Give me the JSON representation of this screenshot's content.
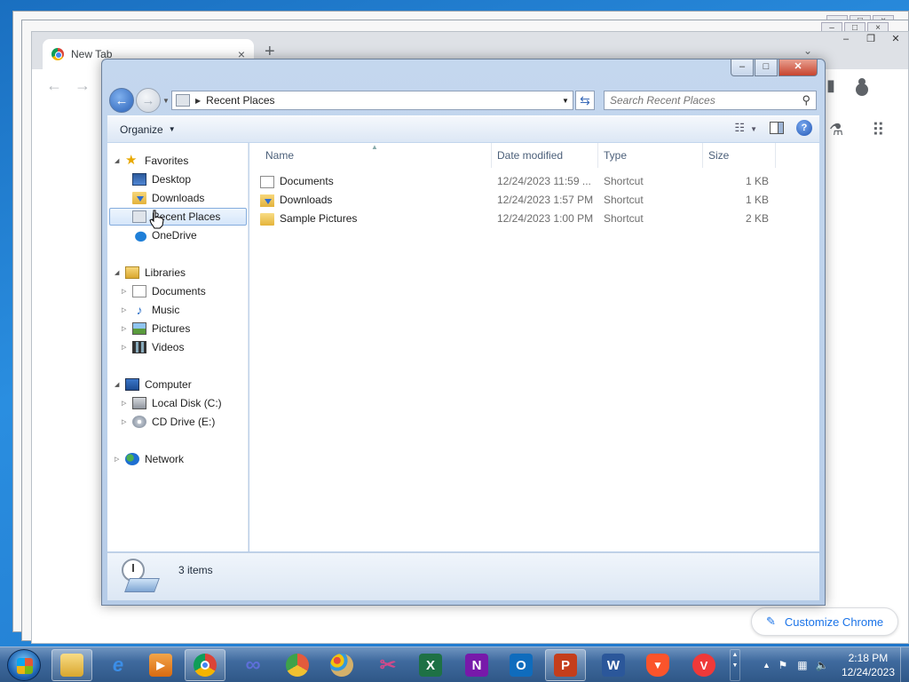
{
  "chrome": {
    "tab_title": "New Tab",
    "tab_close": "×",
    "new_tab": "+",
    "customize_label": "Customize Chrome"
  },
  "explorer": {
    "address_path": "Recent Places",
    "search_placeholder": "Search Recent Places",
    "organize_label": "Organize",
    "nav": {
      "favorites": "Favorites",
      "desktop": "Desktop",
      "downloads": "Downloads",
      "recent_places": "Recent Places",
      "onedrive": "OneDrive",
      "libraries": "Libraries",
      "documents": "Documents",
      "music": "Music",
      "pictures": "Pictures",
      "videos": "Videos",
      "computer": "Computer",
      "local_disk": "Local Disk (C:)",
      "cd_drive": "CD Drive (E:)",
      "network": "Network"
    },
    "columns": {
      "name": "Name",
      "date_modified": "Date modified",
      "type": "Type",
      "size": "Size"
    },
    "files": [
      {
        "name": "Documents",
        "date": "12/24/2023 11:59 ...",
        "type": "Shortcut",
        "size": "1 KB"
      },
      {
        "name": "Downloads",
        "date": "12/24/2023 1:57 PM",
        "type": "Shortcut",
        "size": "1 KB"
      },
      {
        "name": "Sample Pictures",
        "date": "12/24/2023 1:00 PM",
        "type": "Shortcut",
        "size": "2 KB"
      }
    ],
    "status_count": "3 items"
  },
  "taskbar": {
    "time": "2:18 PM",
    "date": "12/24/2023",
    "apps": [
      "file-explorer",
      "internet-explorer",
      "media-player",
      "chrome",
      "infinity",
      "chrome-green",
      "paint",
      "snipping-tool",
      "excel",
      "onenote",
      "outlook",
      "powerpoint",
      "word",
      "brave",
      "vivaldi"
    ]
  },
  "colors": {
    "explorer_frame": "#c4d7ee",
    "selection_border": "#84acdd",
    "taskbar": "#3f6a9e",
    "chrome_accent": "#1a73e8"
  }
}
